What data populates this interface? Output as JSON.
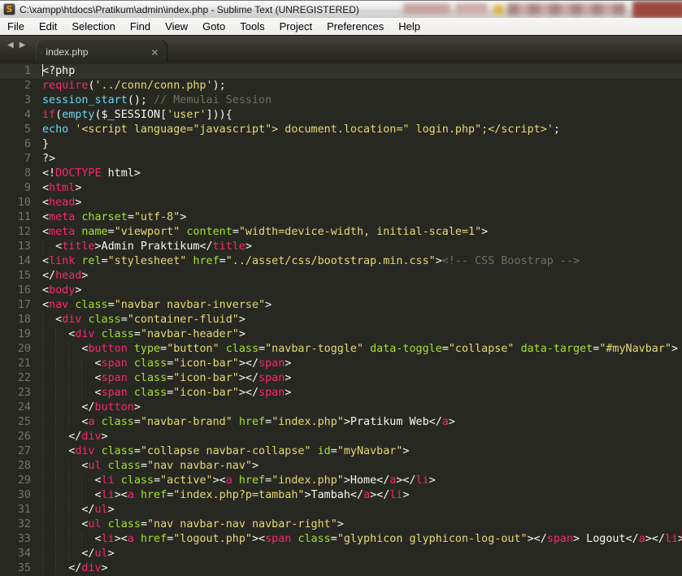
{
  "window": {
    "title": "C:\\xampp\\htdocs\\Pratikum\\admin\\index.php - Sublime Text (UNREGISTERED)",
    "app_icon": "S"
  },
  "menu": {
    "items": [
      "File",
      "Edit",
      "Selection",
      "Find",
      "View",
      "Goto",
      "Tools",
      "Project",
      "Preferences",
      "Help"
    ]
  },
  "tabbar": {
    "scroll_left_icon": "◀",
    "scroll_right_icon": "▶",
    "tabs": [
      {
        "label": "index.php",
        "close_icon": "×",
        "active": true
      }
    ]
  },
  "editor": {
    "cursor_line": 1,
    "colors": {
      "w": "#f8f8f2",
      "p": "#f92672",
      "g": "#a6e22e",
      "y": "#e6db74",
      "c": "#66d9ef",
      "m": "#75715e"
    },
    "background": "#272822",
    "lines": [
      {
        "num": 1,
        "ind": 0,
        "segs": [
          [
            "<?php",
            "w"
          ]
        ]
      },
      {
        "num": 2,
        "ind": 0,
        "segs": [
          [
            "require",
            "p"
          ],
          [
            "(",
            "w"
          ],
          [
            "'../conn/conn.php'",
            "y"
          ],
          [
            ");",
            "w"
          ]
        ]
      },
      {
        "num": 3,
        "ind": 0,
        "segs": [
          [
            "session_start",
            "c"
          ],
          [
            "(); ",
            "w"
          ],
          [
            "// Memulai Session",
            "m"
          ]
        ]
      },
      {
        "num": 4,
        "ind": 0,
        "segs": [
          [
            "if",
            "p"
          ],
          [
            "(",
            "w"
          ],
          [
            "empty",
            "c"
          ],
          [
            "($_SESSION[",
            "w"
          ],
          [
            "'user'",
            "y"
          ],
          [
            "])){",
            "w"
          ]
        ]
      },
      {
        "num": 5,
        "ind": 0,
        "segs": [
          [
            "echo",
            "c"
          ],
          [
            " ",
            "w"
          ],
          [
            "'<script language=\"javascript\"> document.location=\" login.php\";</script>'",
            "y"
          ],
          [
            ";",
            "w"
          ]
        ]
      },
      {
        "num": 6,
        "ind": 0,
        "segs": [
          [
            "}",
            "w"
          ]
        ]
      },
      {
        "num": 7,
        "ind": 0,
        "segs": [
          [
            "?>",
            "w"
          ]
        ]
      },
      {
        "num": 8,
        "ind": 0,
        "segs": [
          [
            "<!",
            "w"
          ],
          [
            "DOCTYPE",
            "p"
          ],
          [
            " html>",
            "w"
          ]
        ]
      },
      {
        "num": 9,
        "ind": 0,
        "segs": [
          [
            "<",
            "w"
          ],
          [
            "html",
            "p"
          ],
          [
            ">",
            "w"
          ]
        ]
      },
      {
        "num": 10,
        "ind": 0,
        "segs": [
          [
            "<",
            "w"
          ],
          [
            "head",
            "p"
          ],
          [
            ">",
            "w"
          ]
        ]
      },
      {
        "num": 11,
        "ind": 0,
        "segs": [
          [
            "<",
            "w"
          ],
          [
            "meta",
            "p"
          ],
          [
            " ",
            "w"
          ],
          [
            "charset",
            "g"
          ],
          [
            "=",
            "w"
          ],
          [
            "\"utf-8\"",
            "y"
          ],
          [
            ">",
            "w"
          ]
        ]
      },
      {
        "num": 12,
        "ind": 0,
        "segs": [
          [
            "<",
            "w"
          ],
          [
            "meta",
            "p"
          ],
          [
            " ",
            "w"
          ],
          [
            "name",
            "g"
          ],
          [
            "=",
            "w"
          ],
          [
            "\"viewport\"",
            "y"
          ],
          [
            " ",
            "w"
          ],
          [
            "content",
            "g"
          ],
          [
            "=",
            "w"
          ],
          [
            "\"width=device-width, initial-scale=1\"",
            "y"
          ],
          [
            ">",
            "w"
          ]
        ]
      },
      {
        "num": 13,
        "ind": 2,
        "segs": [
          [
            "<",
            "w"
          ],
          [
            "title",
            "p"
          ],
          [
            ">Admin Praktikum</",
            "w"
          ],
          [
            "title",
            "p"
          ],
          [
            ">",
            "w"
          ]
        ]
      },
      {
        "num": 14,
        "ind": 0,
        "segs": [
          [
            "<",
            "w"
          ],
          [
            "link",
            "p"
          ],
          [
            " ",
            "w"
          ],
          [
            "rel",
            "g"
          ],
          [
            "=",
            "w"
          ],
          [
            "\"stylesheet\"",
            "y"
          ],
          [
            " ",
            "w"
          ],
          [
            "href",
            "g"
          ],
          [
            "=",
            "w"
          ],
          [
            "\"../asset/css/bootstrap.min.css\"",
            "y"
          ],
          [
            ">",
            "w"
          ],
          [
            "<!-- CSS Boostrap -->",
            "m"
          ]
        ]
      },
      {
        "num": 15,
        "ind": 0,
        "segs": [
          [
            "</",
            "w"
          ],
          [
            "head",
            "p"
          ],
          [
            ">",
            "w"
          ]
        ]
      },
      {
        "num": 16,
        "ind": 0,
        "segs": [
          [
            "<",
            "w"
          ],
          [
            "body",
            "p"
          ],
          [
            ">",
            "w"
          ]
        ]
      },
      {
        "num": 17,
        "ind": 0,
        "segs": [
          [
            "<",
            "w"
          ],
          [
            "nav",
            "p"
          ],
          [
            " ",
            "w"
          ],
          [
            "class",
            "g"
          ],
          [
            "=",
            "w"
          ],
          [
            "\"navbar navbar-inverse\"",
            "y"
          ],
          [
            ">",
            "w"
          ]
        ]
      },
      {
        "num": 18,
        "ind": 2,
        "segs": [
          [
            "<",
            "w"
          ],
          [
            "div",
            "p"
          ],
          [
            " ",
            "w"
          ],
          [
            "class",
            "g"
          ],
          [
            "=",
            "w"
          ],
          [
            "\"container-fluid\"",
            "y"
          ],
          [
            ">",
            "w"
          ]
        ]
      },
      {
        "num": 19,
        "ind": 4,
        "segs": [
          [
            "<",
            "w"
          ],
          [
            "div",
            "p"
          ],
          [
            " ",
            "w"
          ],
          [
            "class",
            "g"
          ],
          [
            "=",
            "w"
          ],
          [
            "\"navbar-header\"",
            "y"
          ],
          [
            ">",
            "w"
          ]
        ]
      },
      {
        "num": 20,
        "ind": 6,
        "segs": [
          [
            "<",
            "w"
          ],
          [
            "button",
            "p"
          ],
          [
            " ",
            "w"
          ],
          [
            "type",
            "g"
          ],
          [
            "=",
            "w"
          ],
          [
            "\"button\"",
            "y"
          ],
          [
            " ",
            "w"
          ],
          [
            "class",
            "g"
          ],
          [
            "=",
            "w"
          ],
          [
            "\"navbar-toggle\"",
            "y"
          ],
          [
            " ",
            "w"
          ],
          [
            "data-toggle",
            "g"
          ],
          [
            "=",
            "w"
          ],
          [
            "\"collapse\"",
            "y"
          ],
          [
            " ",
            "w"
          ],
          [
            "data-target",
            "g"
          ],
          [
            "=",
            "w"
          ],
          [
            "\"#myNavbar\"",
            "y"
          ],
          [
            ">",
            "w"
          ]
        ]
      },
      {
        "num": 21,
        "ind": 8,
        "segs": [
          [
            "<",
            "w"
          ],
          [
            "span",
            "p"
          ],
          [
            " ",
            "w"
          ],
          [
            "class",
            "g"
          ],
          [
            "=",
            "w"
          ],
          [
            "\"icon-bar\"",
            "y"
          ],
          [
            "></",
            "w"
          ],
          [
            "span",
            "p"
          ],
          [
            ">",
            "w"
          ]
        ]
      },
      {
        "num": 22,
        "ind": 8,
        "segs": [
          [
            "<",
            "w"
          ],
          [
            "span",
            "p"
          ],
          [
            " ",
            "w"
          ],
          [
            "class",
            "g"
          ],
          [
            "=",
            "w"
          ],
          [
            "\"icon-bar\"",
            "y"
          ],
          [
            "></",
            "w"
          ],
          [
            "span",
            "p"
          ],
          [
            ">",
            "w"
          ]
        ]
      },
      {
        "num": 23,
        "ind": 8,
        "segs": [
          [
            "<",
            "w"
          ],
          [
            "span",
            "p"
          ],
          [
            " ",
            "w"
          ],
          [
            "class",
            "g"
          ],
          [
            "=",
            "w"
          ],
          [
            "\"icon-bar\"",
            "y"
          ],
          [
            "></",
            "w"
          ],
          [
            "span",
            "p"
          ],
          [
            ">",
            "w"
          ]
        ]
      },
      {
        "num": 24,
        "ind": 6,
        "segs": [
          [
            "</",
            "w"
          ],
          [
            "button",
            "p"
          ],
          [
            ">",
            "w"
          ]
        ]
      },
      {
        "num": 25,
        "ind": 6,
        "segs": [
          [
            "<",
            "w"
          ],
          [
            "a",
            "p"
          ],
          [
            " ",
            "w"
          ],
          [
            "class",
            "g"
          ],
          [
            "=",
            "w"
          ],
          [
            "\"navbar-brand\"",
            "y"
          ],
          [
            " ",
            "w"
          ],
          [
            "href",
            "g"
          ],
          [
            "=",
            "w"
          ],
          [
            "\"index.php\"",
            "y"
          ],
          [
            ">Pratikum Web</",
            "w"
          ],
          [
            "a",
            "p"
          ],
          [
            ">",
            "w"
          ]
        ]
      },
      {
        "num": 26,
        "ind": 4,
        "segs": [
          [
            "</",
            "w"
          ],
          [
            "div",
            "p"
          ],
          [
            ">",
            "w"
          ]
        ]
      },
      {
        "num": 27,
        "ind": 4,
        "segs": [
          [
            "<",
            "w"
          ],
          [
            "div",
            "p"
          ],
          [
            " ",
            "w"
          ],
          [
            "class",
            "g"
          ],
          [
            "=",
            "w"
          ],
          [
            "\"collapse navbar-collapse\"",
            "y"
          ],
          [
            " ",
            "w"
          ],
          [
            "id",
            "g"
          ],
          [
            "=",
            "w"
          ],
          [
            "\"myNavbar\"",
            "y"
          ],
          [
            ">",
            "w"
          ]
        ]
      },
      {
        "num": 28,
        "ind": 6,
        "segs": [
          [
            "<",
            "w"
          ],
          [
            "ul",
            "p"
          ],
          [
            " ",
            "w"
          ],
          [
            "class",
            "g"
          ],
          [
            "=",
            "w"
          ],
          [
            "\"nav navbar-nav\"",
            "y"
          ],
          [
            ">",
            "w"
          ]
        ]
      },
      {
        "num": 29,
        "ind": 8,
        "segs": [
          [
            "<",
            "w"
          ],
          [
            "li",
            "p"
          ],
          [
            " ",
            "w"
          ],
          [
            "class",
            "g"
          ],
          [
            "=",
            "w"
          ],
          [
            "\"active\"",
            "y"
          ],
          [
            "><",
            "w"
          ],
          [
            "a",
            "p"
          ],
          [
            " ",
            "w"
          ],
          [
            "href",
            "g"
          ],
          [
            "=",
            "w"
          ],
          [
            "\"index.php\"",
            "y"
          ],
          [
            ">Home</",
            "w"
          ],
          [
            "a",
            "p"
          ],
          [
            "></",
            "w"
          ],
          [
            "li",
            "p"
          ],
          [
            ">",
            "w"
          ]
        ]
      },
      {
        "num": 30,
        "ind": 8,
        "segs": [
          [
            "<",
            "w"
          ],
          [
            "li",
            "p"
          ],
          [
            "><",
            "w"
          ],
          [
            "a",
            "p"
          ],
          [
            " ",
            "w"
          ],
          [
            "href",
            "g"
          ],
          [
            "=",
            "w"
          ],
          [
            "\"index.php?p=tambah\"",
            "y"
          ],
          [
            ">Tambah</",
            "w"
          ],
          [
            "a",
            "p"
          ],
          [
            "></",
            "w"
          ],
          [
            "li",
            "p"
          ],
          [
            ">",
            "w"
          ]
        ]
      },
      {
        "num": 31,
        "ind": 6,
        "segs": [
          [
            "</",
            "w"
          ],
          [
            "ul",
            "p"
          ],
          [
            ">",
            "w"
          ]
        ]
      },
      {
        "num": 32,
        "ind": 6,
        "segs": [
          [
            "<",
            "w"
          ],
          [
            "ul",
            "p"
          ],
          [
            " ",
            "w"
          ],
          [
            "class",
            "g"
          ],
          [
            "=",
            "w"
          ],
          [
            "\"nav navbar-nav navbar-right\"",
            "y"
          ],
          [
            ">",
            "w"
          ]
        ]
      },
      {
        "num": 33,
        "ind": 8,
        "segs": [
          [
            "<",
            "w"
          ],
          [
            "li",
            "p"
          ],
          [
            "><",
            "w"
          ],
          [
            "a",
            "p"
          ],
          [
            " ",
            "w"
          ],
          [
            "href",
            "g"
          ],
          [
            "=",
            "w"
          ],
          [
            "\"logout.php\"",
            "y"
          ],
          [
            "><",
            "w"
          ],
          [
            "span",
            "p"
          ],
          [
            " ",
            "w"
          ],
          [
            "class",
            "g"
          ],
          [
            "=",
            "w"
          ],
          [
            "\"glyphicon glyphicon-log-out\"",
            "y"
          ],
          [
            "></",
            "w"
          ],
          [
            "span",
            "p"
          ],
          [
            "> Logout</",
            "w"
          ],
          [
            "a",
            "p"
          ],
          [
            "></",
            "w"
          ],
          [
            "li",
            "p"
          ],
          [
            ">",
            "w"
          ]
        ]
      },
      {
        "num": 34,
        "ind": 6,
        "segs": [
          [
            "</",
            "w"
          ],
          [
            "ul",
            "p"
          ],
          [
            ">",
            "w"
          ]
        ]
      },
      {
        "num": 35,
        "ind": 4,
        "segs": [
          [
            "</",
            "w"
          ],
          [
            "div",
            "p"
          ],
          [
            ">",
            "w"
          ]
        ]
      }
    ]
  }
}
